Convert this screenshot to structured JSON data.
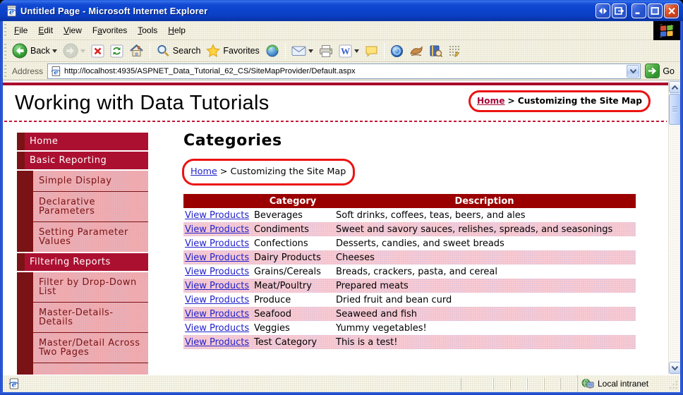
{
  "window": {
    "title": "Untitled Page - Microsoft Internet Explorer"
  },
  "menubar": {
    "items": [
      {
        "pre": "",
        "u": "F",
        "rest": "ile"
      },
      {
        "pre": "",
        "u": "E",
        "rest": "dit"
      },
      {
        "pre": "",
        "u": "V",
        "rest": "iew"
      },
      {
        "pre": "F",
        "u": "a",
        "rest": "vorites"
      },
      {
        "pre": "",
        "u": "T",
        "rest": "ools"
      },
      {
        "pre": "",
        "u": "H",
        "rest": "elp"
      }
    ]
  },
  "toolbar": {
    "back_label": "Back",
    "search_label": "Search",
    "favorites_label": "Favorites"
  },
  "addressbar": {
    "label": "Address",
    "url": "http://localhost:4935/ASPNET_Data_Tutorial_62_CS/SiteMapProvider/Default.aspx",
    "go_label": "Go"
  },
  "page": {
    "title": "Working with Data Tutorials",
    "heading": "Categories",
    "breadcrumb_top": {
      "home": "Home",
      "sep": ">",
      "current": "Customizing the Site Map"
    },
    "breadcrumb_main": {
      "home": "Home",
      "sep": ">",
      "current": "Customizing the Site Map"
    }
  },
  "sidebar": {
    "items": [
      {
        "label": "Home",
        "level": 1
      },
      {
        "label": "Basic Reporting",
        "level": 1
      },
      {
        "label": "Simple Display",
        "level": 2
      },
      {
        "label": "Declarative Parameters",
        "level": 2
      },
      {
        "label": "Setting Parameter Values",
        "level": 2
      },
      {
        "label": "Filtering Reports",
        "level": 1
      },
      {
        "label": "Filter by Drop-Down List",
        "level": 2
      },
      {
        "label": "Master-Details-Details",
        "level": 2
      },
      {
        "label": "Master/Detail Across Two Pages",
        "level": 2
      },
      {
        "label": "",
        "level": 2
      }
    ]
  },
  "table": {
    "headers": [
      "",
      "Category",
      "Description"
    ],
    "link_label": "View Products",
    "rows": [
      {
        "category": "Beverages",
        "description": "Soft drinks, coffees, teas, beers, and ales"
      },
      {
        "category": "Condiments",
        "description": "Sweet and savory sauces, relishes, spreads, and seasonings"
      },
      {
        "category": "Confections",
        "description": "Desserts, candies, and sweet breads"
      },
      {
        "category": "Dairy Products",
        "description": "Cheeses"
      },
      {
        "category": "Grains/Cereals",
        "description": "Breads, crackers, pasta, and cereal"
      },
      {
        "category": "Meat/Poultry",
        "description": "Prepared meats"
      },
      {
        "category": "Produce",
        "description": "Dried fruit and bean curd"
      },
      {
        "category": "Seafood",
        "description": "Seaweed and fish"
      },
      {
        "category": "Veggies",
        "description": "Yummy vegetables!"
      },
      {
        "category": "Test Category",
        "description": "This is a test!"
      }
    ]
  },
  "statusbar": {
    "zone_label": "Local intranet"
  },
  "colors": {
    "crimson_menu": "#AC1031",
    "maroon_dark": "#7A1315",
    "sidebar_pink": "#ECA3A7",
    "table_header_maroon": "#9A0000",
    "table_alt_pink": "#FCC9CE",
    "link_blue": "#2222CC",
    "header_link_crimson": "#A5093B",
    "annotation_red": "#EC1313",
    "page_topbar_red": "#A90C2B",
    "titlebar_blue": "#0C44CE",
    "chrome_beige": "#ECE9D8"
  }
}
